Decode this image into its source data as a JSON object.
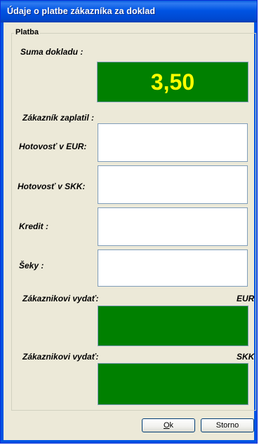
{
  "window": {
    "title": "Údaje o platbe zákazníka za doklad"
  },
  "group": {
    "label": "Platba"
  },
  "total": {
    "label": "Suma dokladu :",
    "value": "3,50",
    "value_color": "#ffff00",
    "bg_color": "#008000"
  },
  "paid": {
    "label": "Zákazník zaplatil :"
  },
  "fields": [
    {
      "label": "Hotovosť v EUR:",
      "value": ""
    },
    {
      "label": "Hotovosť v SKK:",
      "value": ""
    },
    {
      "label": "Kredit :",
      "value": ""
    },
    {
      "label": "Šeky :",
      "value": ""
    }
  ],
  "change": [
    {
      "label": "Zákaznikovi vydať:",
      "currency": "EUR",
      "value": ""
    },
    {
      "label": "Zákaznikovi vydať:",
      "currency": "SKK",
      "value": ""
    }
  ],
  "buttons": {
    "ok_mnemonic": "O",
    "ok_rest": "k",
    "cancel": "Storno"
  }
}
